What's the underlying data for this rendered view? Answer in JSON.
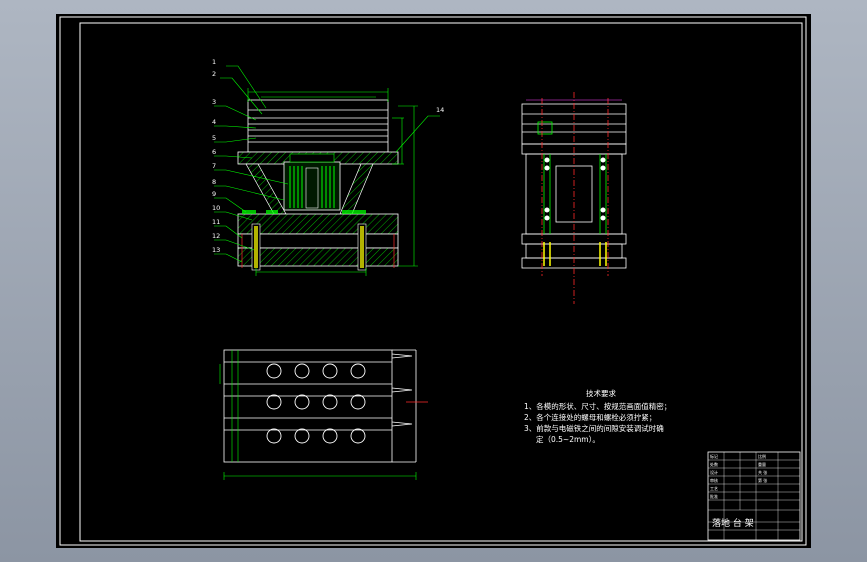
{
  "part_numbers": [
    "1",
    "2",
    "3",
    "4",
    "5",
    "6",
    "7",
    "8",
    "9",
    "10",
    "11",
    "12",
    "13"
  ],
  "callout_right": "14",
  "tech_requirements": {
    "title": "技术要求",
    "lines": [
      "1、各模的形状、尺寸、按规范画面值精密；",
      "2、各个连接处的螺母和螺栓必须拧紧；",
      "3、前款与电磁铁之间的间隙安装调试时确",
      "定（0.5~2mm）。"
    ]
  },
  "title_block": {
    "large_text": "落地 台 架",
    "small_labels": [
      "标记",
      "处数",
      "设计",
      "审核",
      "工艺",
      "批准",
      "比例",
      "重量",
      "共 张",
      "第 张"
    ]
  },
  "colors": {
    "frame": "#ffffff",
    "outline": "#ffffff",
    "green": "#00ff00",
    "red": "#ff2a2a",
    "yellow": "#ffff00",
    "magenta": "#ff44ff"
  }
}
